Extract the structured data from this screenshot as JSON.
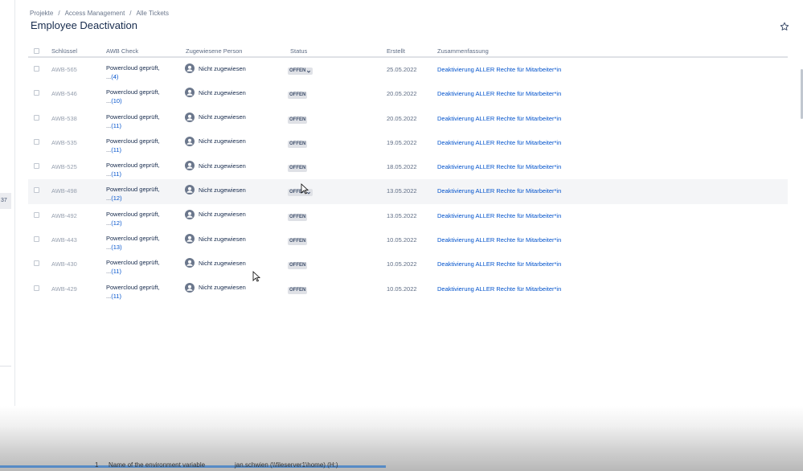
{
  "breadcrumb": {
    "projects": "Projekte",
    "project": "Access Management",
    "queue": "Alle Tickets",
    "separator": "/"
  },
  "page": {
    "title": "Employee Deactivation"
  },
  "sidebar": {
    "counter": "37"
  },
  "columns": {
    "key": "Schlüssel",
    "awb": "AWB Check",
    "assignee": "Zugewiesene Person",
    "status": "Status",
    "created": "Erstellt",
    "summary": "Zusammenfassung"
  },
  "rows": [
    {
      "key": "AWB-565",
      "awb": "Powercloud geprüft,",
      "more": "...",
      "count": "(4)",
      "assignee": "Nicht zugewiesen",
      "status": "OFFEN",
      "created": "25.05.2022",
      "summary": "Deaktivierung ALLER Rechte für Mitarbeiter*in"
    },
    {
      "key": "AWB-546",
      "awb": "Powercloud geprüft,",
      "more": "...",
      "count": "(10)",
      "assignee": "Nicht zugewiesen",
      "status": "OFFEN",
      "created": "20.05.2022",
      "summary": "Deaktivierung ALLER Rechte für Mitarbeiter*in"
    },
    {
      "key": "AWB-538",
      "awb": "Powercloud geprüft,",
      "more": "...",
      "count": "(11)",
      "assignee": "Nicht zugewiesen",
      "status": "OFFEN",
      "created": "20.05.2022",
      "summary": "Deaktivierung ALLER Rechte für Mitarbeiter*in"
    },
    {
      "key": "AWB-535",
      "awb": "Powercloud geprüft,",
      "more": "...",
      "count": "(11)",
      "assignee": "Nicht zugewiesen",
      "status": "OFFEN",
      "created": "19.05.2022",
      "summary": "Deaktivierung ALLER Rechte für Mitarbeiter*in"
    },
    {
      "key": "AWB-525",
      "awb": "Powercloud geprüft,",
      "more": "...",
      "count": "(11)",
      "assignee": "Nicht zugewiesen",
      "status": "OFFEN",
      "created": "18.05.2022",
      "summary": "Deaktivierung ALLER Rechte für Mitarbeiter*in"
    },
    {
      "key": "AWB-498",
      "awb": "Powercloud geprüft,",
      "more": "...",
      "count": "(12)",
      "assignee": "Nicht zugewiesen",
      "status": "OFFEN",
      "created": "13.05.2022",
      "summary": "Deaktivierung ALLER Rechte für Mitarbeiter*in"
    },
    {
      "key": "AWB-492",
      "awb": "Powercloud geprüft,",
      "more": "...",
      "count": "(12)",
      "assignee": "Nicht zugewiesen",
      "status": "OFFEN",
      "created": "13.05.2022",
      "summary": "Deaktivierung ALLER Rechte für Mitarbeiter*in"
    },
    {
      "key": "AWB-443",
      "awb": "Powercloud geprüft,",
      "more": "...",
      "count": "(13)",
      "assignee": "Nicht zugewiesen",
      "status": "OFFEN",
      "created": "10.05.2022",
      "summary": "Deaktivierung ALLER Rechte für Mitarbeiter*in"
    },
    {
      "key": "AWB-430",
      "awb": "Powercloud geprüft,",
      "more": "...",
      "count": "(11)",
      "assignee": "Nicht zugewiesen",
      "status": "OFFEN",
      "created": "10.05.2022",
      "summary": "Deaktivierung ALLER Rechte für Mitarbeiter*in"
    },
    {
      "key": "AWB-429",
      "awb": "Powercloud geprüft,",
      "more": "...",
      "count": "(11)",
      "assignee": "Nicht zugewiesen",
      "status": "OFFEN",
      "created": "10.05.2022",
      "summary": "Deaktivierung ALLER Rechte für Mitarbeiter*in"
    }
  ],
  "taskbar": {
    "index": "1",
    "item1": "Name of the environment variable",
    "item2": "jan.schwien (\\\\fileserver1\\home) (H:)"
  },
  "colors": {
    "link": "#0052cc",
    "text": "#172b4d",
    "muted": "#6b778c",
    "lozenge_bg": "#dfe1e6"
  },
  "icons": {
    "star": "star-icon",
    "avatar": "default-avatar-icon",
    "chevron": "chevron-down-icon"
  }
}
